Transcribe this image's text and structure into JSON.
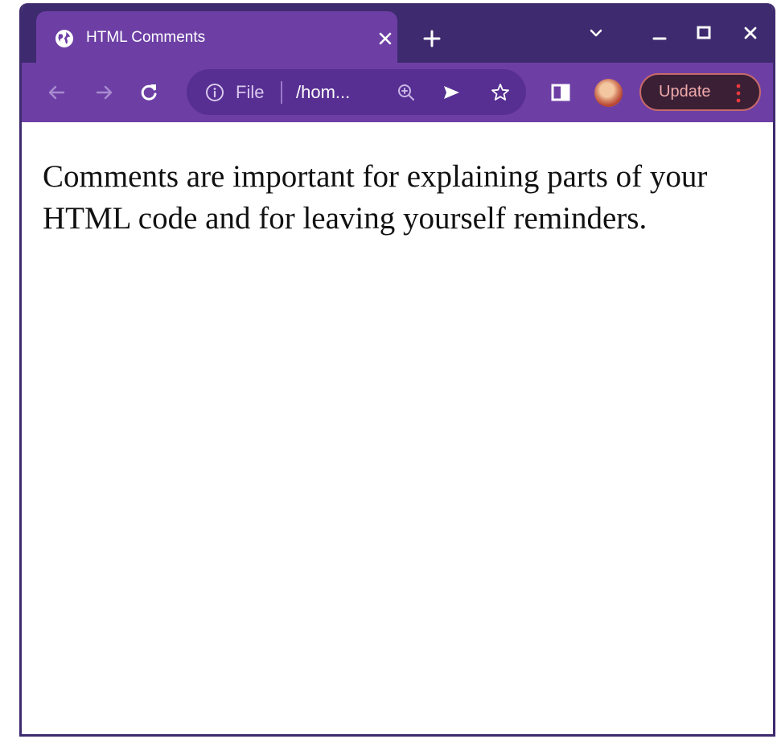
{
  "browser": {
    "tab": {
      "title": "HTML Comments",
      "favicon": "globe-icon"
    },
    "toolbar": {
      "omnibox": {
        "scheme_label": "File",
        "url_display": "/hom..."
      },
      "update_label": "Update"
    },
    "colors": {
      "frame": "#3e2a6e",
      "toolbar": "#6d3fa5",
      "omnibox": "#572f92",
      "update_border": "#c86a6a"
    }
  },
  "page": {
    "paragraph": "Comments are important for explaining parts of your HTML code and for leaving yourself reminders."
  }
}
